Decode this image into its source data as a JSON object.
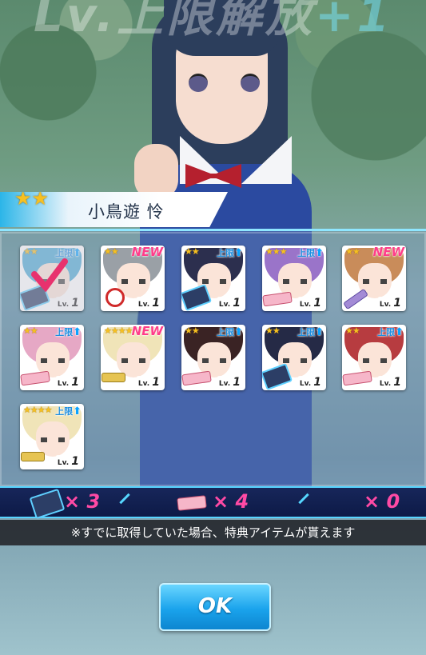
{
  "screen_title": "Lv.上限解放+1",
  "title_main": "Lv.上限解放",
  "title_plus": "+1",
  "character": {
    "name": "小鳥遊 怜",
    "stars": "★★"
  },
  "cards": [
    {
      "stars": "★★",
      "badge": "上限",
      "level": "1",
      "hair": "#4aa9d6",
      "item": "book",
      "checked": true
    },
    {
      "stars": "★★",
      "badge": "NEW",
      "level": "1",
      "hair": "#9aa0a6",
      "item": "target"
    },
    {
      "stars": "★★",
      "badge": "上限",
      "level": "1",
      "hair": "#2c2f4e",
      "item": "book"
    },
    {
      "stars": "★★★",
      "badge": "上限",
      "level": "1",
      "hair": "#9a74c9",
      "item": "ticket"
    },
    {
      "stars": "★★",
      "badge": "NEW",
      "level": "1",
      "hair": "#c98c5a",
      "item": "pencil"
    },
    {
      "stars": "★★",
      "badge": "上限",
      "level": "1",
      "hair": "#e6a8c5",
      "item": "ticket"
    },
    {
      "stars": "★★★★",
      "badge": "NEW",
      "level": "1",
      "hair": "#f0e4b8",
      "item": "key"
    },
    {
      "stars": "★★",
      "badge": "上限",
      "level": "1",
      "hair": "#3a2324",
      "item": "ticket"
    },
    {
      "stars": "★★",
      "badge": "上限",
      "level": "1",
      "hair": "#252a46",
      "item": "book"
    },
    {
      "stars": "★★",
      "badge": "上限",
      "level": "1",
      "hair": "#b73c40",
      "item": "ticket"
    },
    {
      "stars": "★★★★",
      "badge": "上限",
      "level": "1",
      "hair": "#f0e4b8",
      "item": "key"
    }
  ],
  "lv_prefix": "Lv.",
  "counters": {
    "book": "× 3",
    "ticket": "× 4",
    "other": "× 0"
  },
  "notice": "※すでに取得していた場合、特典アイテムが貰えます",
  "ok_label": "OK"
}
